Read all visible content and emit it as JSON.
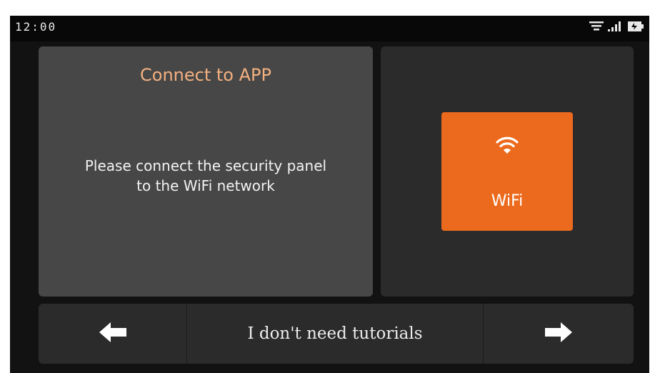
{
  "status_bar": {
    "time": "12:00",
    "icons": [
      "wifi-icon",
      "signal-icon",
      "battery-icon"
    ]
  },
  "info_panel": {
    "title": "Connect to APP",
    "message_line1": "Please connect the security panel",
    "message_line2": "to the WiFi network"
  },
  "wifi_panel": {
    "button_label": "WiFi",
    "icon": "wifi-icon"
  },
  "nav": {
    "back_icon": "arrow-left-icon",
    "skip_label": "I don't need tutorials",
    "next_icon": "arrow-right-icon"
  },
  "colors": {
    "screen_bg": "#121212",
    "info_panel_bg": "#474747",
    "wifi_panel_bg": "#2b2b2b",
    "accent_orange": "#ec6a1d",
    "title_color": "#f3b080",
    "text_color": "#f2f2f2"
  }
}
